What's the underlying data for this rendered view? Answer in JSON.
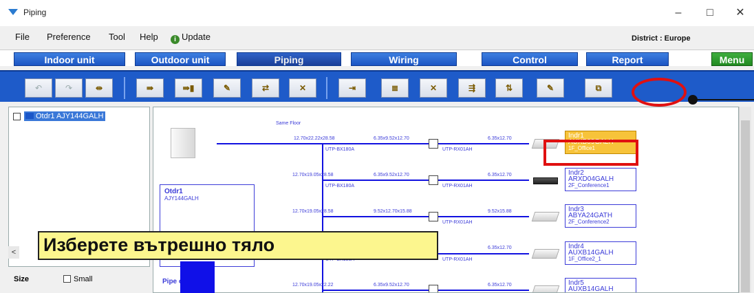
{
  "window": {
    "title": "Piping",
    "minimize": "–",
    "maximize": "□",
    "close": "✕"
  },
  "menu": {
    "file": "File",
    "preference": "Preference",
    "tool": "Tool",
    "help": "Help",
    "update": "Update",
    "district": "District : Europe"
  },
  "tabs": [
    {
      "label": "Indoor unit"
    },
    {
      "label": "Outdoor unit"
    },
    {
      "label": "Piping"
    },
    {
      "label": "Wiring"
    },
    {
      "label": "Control"
    },
    {
      "label": "Report"
    },
    {
      "label": "Menu"
    }
  ],
  "tree": {
    "item": "Otdr1 AJY144GALH"
  },
  "size": {
    "label": "Size",
    "small": "Small"
  },
  "diagram": {
    "same_floor": "Same Floor",
    "main_pipes": [
      "12.70x22.22x28.58",
      "12.70x19.05x28.58",
      "12.70x19.05x28.58",
      "12.70x19.05x22.22"
    ],
    "branch_pipes": [
      "6.35x9.52x12.70",
      "6.35x9.52x12.70",
      "9.52x12.70x15.88",
      "6.35x9.52x12.70"
    ],
    "joints": [
      "UTP-BX180A",
      "UTP-BX180A",
      "UTP-BX180A"
    ],
    "rx_joints": [
      "UTP-RX01AH",
      "UTP-RX01AH",
      "UTP-RX01AH",
      "UTP-RX01AH"
    ],
    "indoor_pipes": [
      "6.35x12.70",
      "6.35x12.70",
      "9.52x15.88",
      "6.35x12.70",
      "6.35x12.70"
    ],
    "indoor_units": [
      {
        "name": "Indr1",
        "model": "AUXB09GALH",
        "room": "1F_Office1"
      },
      {
        "name": "Indr2",
        "model": "ARXD04GALH",
        "room": "2F_Conference1"
      },
      {
        "name": "Indr3",
        "model": "ABYA24GATH",
        "room": "2F_Conference2"
      },
      {
        "name": "Indr4",
        "model": "AUXB14GALH",
        "room": "1F_Office2_1"
      },
      {
        "name": "Indr5",
        "model": "AUXB14GALH",
        "room": ""
      }
    ],
    "outdoor": {
      "name": "Otdr1",
      "model": "AJY144GALH"
    },
    "pipe_notes": "Pipe    ory notes"
  },
  "banner": "Изберете вътрешно тяло"
}
